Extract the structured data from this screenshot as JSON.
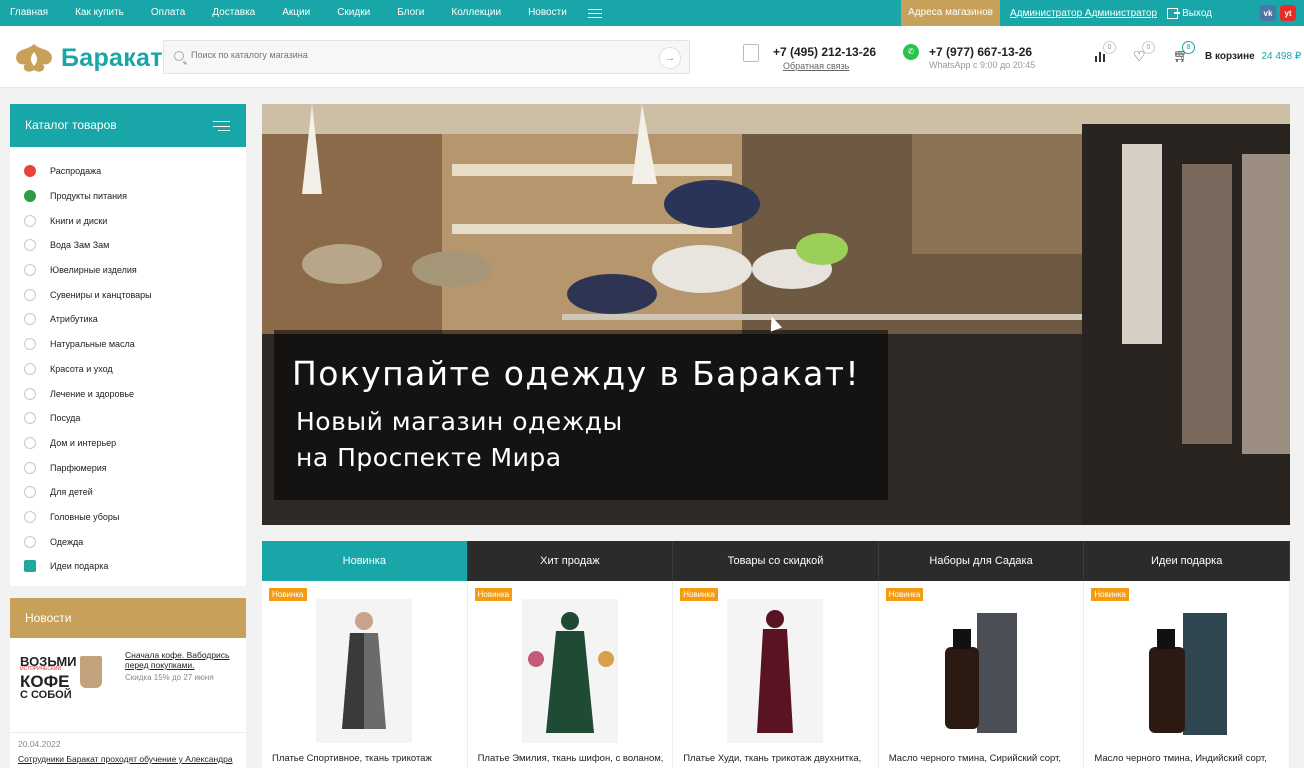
{
  "topnav": {
    "links": [
      "Главная",
      "Как купить",
      "Оплата",
      "Доставка",
      "Акции",
      "Скидки",
      "Блоги",
      "Коллекции",
      "Новости"
    ],
    "stores": "Адреса магазинов",
    "admin": "Администратор Администратор",
    "logout": "Выход",
    "vk": "vk",
    "yt": "yt"
  },
  "header": {
    "logo": "Баракат",
    "search_placeholder": "Поиск по каталогу магазина",
    "phone1": "+7 (495) 212-13-26",
    "phone1_sub": "Обратная связь",
    "phone2": "+7 (977) 667-13-26",
    "phone2_sub": "WhatsApp с 9:00 до 20:45",
    "compare_count": "0",
    "fav_count": "0",
    "cart_count": "8",
    "cart_label": "В корзине",
    "cart_sum": "24 498 ₽"
  },
  "catalog": {
    "title": "Каталог товаров",
    "items": [
      {
        "label": "Распродажа",
        "icon": "sale-icon"
      },
      {
        "label": "Продукты питания",
        "icon": "crescent-icon"
      },
      {
        "label": "Книги и диски",
        "icon": "book-icon"
      },
      {
        "label": "Вода Зам Зам",
        "icon": "water-icon"
      },
      {
        "label": "Ювелирные изделия",
        "icon": "diamond-icon"
      },
      {
        "label": "Сувениры и канцтовары",
        "icon": "souvenir-icon"
      },
      {
        "label": "Атрибутика",
        "icon": "compass-icon"
      },
      {
        "label": "Натуральные масла",
        "icon": "oil-icon"
      },
      {
        "label": "Красота и уход",
        "icon": "beauty-icon"
      },
      {
        "label": "Лечение и здоровье",
        "icon": "health-icon"
      },
      {
        "label": "Посуда",
        "icon": "dishes-icon"
      },
      {
        "label": "Дом и интерьер",
        "icon": "home-icon"
      },
      {
        "label": "Парфюмерия",
        "icon": "perfume-icon"
      },
      {
        "label": "Для детей",
        "icon": "kids-icon"
      },
      {
        "label": "Головные уборы",
        "icon": "hat-icon"
      },
      {
        "label": "Одежда",
        "icon": "clothes-icon"
      },
      {
        "label": "Идеи подарка",
        "icon": "gift-icon"
      }
    ]
  },
  "news": {
    "title": "Новости",
    "promo": {
      "w1": "ВОЗЬМИ",
      "w2": "ИСТОРИЧЕСКИЙ",
      "w3": "КОФЕ",
      "w4": "С СОБОЙ"
    },
    "item1_title": "Сначала кофе. Вабодрись перед покупками.",
    "item1_sub": "Скидка 15% до 27 июня",
    "item2_date": "20.04.2022",
    "item2_title": "Сотрудники Баракат проходят обучение у Александра"
  },
  "banner": {
    "title": "Покупайте одежду в Баракат!",
    "sub1": "Новый магазин одежды",
    "sub2": "на Проспекте Мира"
  },
  "tabs": [
    "Новинка",
    "Хит продаж",
    "Товары со скидкой",
    "Наборы для Садака",
    "Идеи подарка"
  ],
  "products": [
    {
      "tag": "Новинка",
      "name": "Платье Спортивное, ткань трикотаж",
      "color": "#6b6b6b"
    },
    {
      "tag": "Новинка",
      "name": "Платье Эмилия, ткань шифон, с воланом,",
      "color": "#1f4a33"
    },
    {
      "tag": "Новинка",
      "name": "Платье Худи, ткань трикотаж двухнитка,",
      "color": "#5a1322"
    },
    {
      "tag": "Новинка",
      "name": "Масло черного тмина, Сирийский сорт,",
      "color": "#4b4f55"
    },
    {
      "tag": "Новинка",
      "name": "Масло черного тмина, Индийский сорт,",
      "color": "#2f4550"
    }
  ],
  "colors": {
    "accent": "#18a6a8",
    "gold": "#c7a05a",
    "dark": "#2b2b2b",
    "tag": "#f39c12"
  }
}
